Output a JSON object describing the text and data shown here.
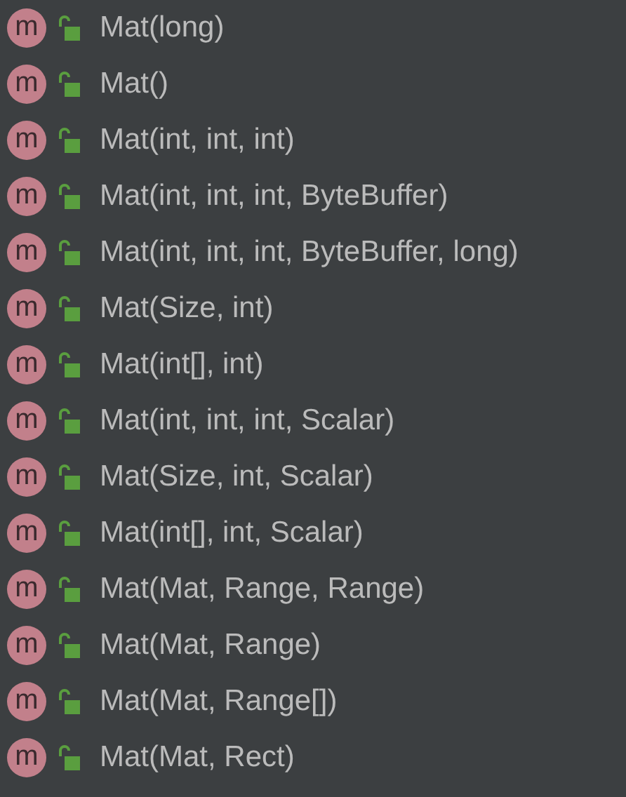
{
  "completion_items": [
    {
      "badge": "m",
      "label": "Mat(long)"
    },
    {
      "badge": "m",
      "label": "Mat()"
    },
    {
      "badge": "m",
      "label": "Mat(int, int, int)"
    },
    {
      "badge": "m",
      "label": "Mat(int, int, int, ByteBuffer)"
    },
    {
      "badge": "m",
      "label": "Mat(int, int, int, ByteBuffer, long)"
    },
    {
      "badge": "m",
      "label": "Mat(Size, int)"
    },
    {
      "badge": "m",
      "label": "Mat(int[], int)"
    },
    {
      "badge": "m",
      "label": "Mat(int, int, int, Scalar)"
    },
    {
      "badge": "m",
      "label": "Mat(Size, int, Scalar)"
    },
    {
      "badge": "m",
      "label": "Mat(int[], int, Scalar)"
    },
    {
      "badge": "m",
      "label": "Mat(Mat, Range, Range)"
    },
    {
      "badge": "m",
      "label": "Mat(Mat, Range)"
    },
    {
      "badge": "m",
      "label": "Mat(Mat, Range[])"
    },
    {
      "badge": "m",
      "label": "Mat(Mat, Rect)"
    }
  ]
}
